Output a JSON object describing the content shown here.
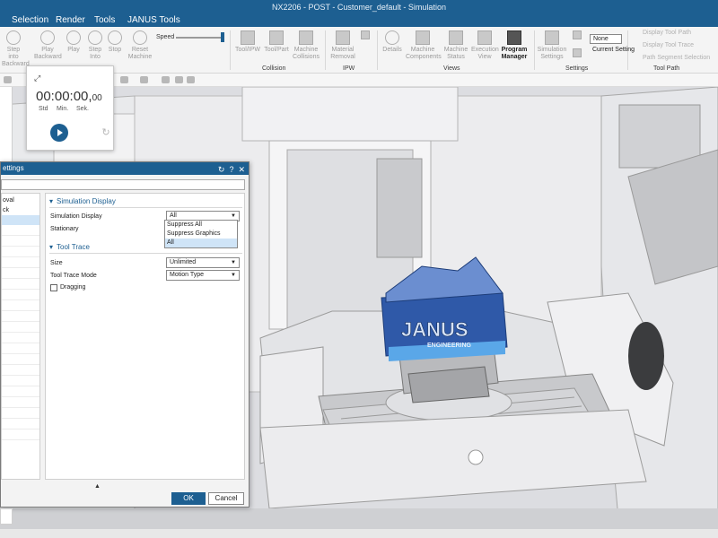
{
  "window": {
    "title": "NX2206 - POST - Customer_default - Simulation"
  },
  "menu": [
    "Selection",
    "Render",
    "Tools",
    "JANUS Tools"
  ],
  "ribbon": {
    "playback": [
      {
        "label": "Step into Backward",
        "icon": "step-back-icon"
      },
      {
        "label": "Play Backward",
        "icon": "play-backward-icon"
      },
      {
        "label": "Play",
        "icon": "play-icon"
      },
      {
        "label": "Step Into",
        "icon": "step-into-icon"
      },
      {
        "label": "Stop",
        "icon": "stop-icon"
      },
      {
        "label": "Reset Machine",
        "icon": "reset-icon"
      }
    ],
    "speed_label": "Speed",
    "speed_level": 1.0,
    "collision": {
      "group_label": "Collision",
      "items": [
        "Tool/IPW",
        "Tool/Part",
        "Machine Collisions"
      ]
    },
    "ipw": {
      "group_label": "IPW",
      "items": [
        "Material Removal"
      ]
    },
    "views": {
      "group_label": "Views",
      "items": [
        "Details",
        "Machine Components",
        "Machine Status",
        "Execution View",
        "Program Manager"
      ]
    },
    "settings": {
      "group_label": "Settings",
      "items": [
        "Simulation Settings"
      ],
      "current_value": "None",
      "current_label": "Current Setting"
    },
    "toolpath": {
      "group_label": "Tool Path",
      "items": [
        "Display Tool Path",
        "Display Tool Trace",
        "Path Segment Selection"
      ]
    }
  },
  "timer": {
    "time_main": "00:00:00,",
    "time_frac": "00",
    "units": [
      "Std",
      "Min.",
      "Sek."
    ]
  },
  "dialog": {
    "title": "ettings",
    "list_items": [
      "oval",
      "ck"
    ],
    "sim_display_section": "Simulation Display",
    "sim_display_label": "Simulation Display",
    "sim_display_value": "All",
    "stationary_label": "Stationary",
    "dropdown_options": [
      "Suppress All",
      "Suppress Graphics",
      "All"
    ],
    "tool_trace_section": "Tool Trace",
    "size_label": "Size",
    "size_value": "Unlimited",
    "trace_mode_label": "Tool Trace Mode",
    "trace_mode_value": "Motion Type",
    "dragging_label": "Dragging",
    "ok_label": "OK",
    "cancel_label": "Cancel"
  },
  "part": {
    "brand": "JANUS",
    "subtitle": "ENGINEERING"
  },
  "colors": {
    "accent": "#1d5f91",
    "selection": "#cfe4f7",
    "part_blue": "#2f59a8"
  }
}
